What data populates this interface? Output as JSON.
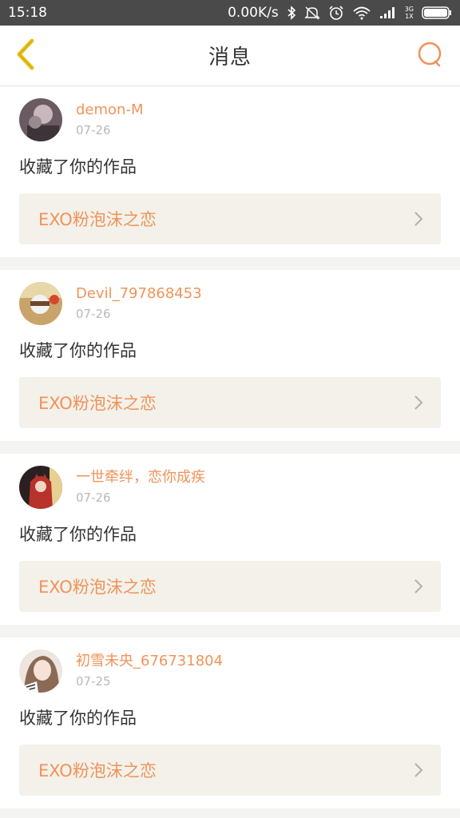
{
  "status_bar": {
    "time": "15:18",
    "net_speed": "0.00K/s",
    "icons": [
      "bluetooth-icon",
      "mute-icon",
      "alarm-icon",
      "wifi-icon",
      "signal-icon",
      "battery-icon"
    ],
    "network_label_top": "3G",
    "network_label_bottom": "1X"
  },
  "header": {
    "title": "消息",
    "back_icon": "chevron-left-icon",
    "search_icon": "search-icon"
  },
  "colors": {
    "accent": "#f0935a",
    "back_icon": "#e8c21a",
    "card_link_bg": "#f3f1e9",
    "page_bg": "#f4f4f2",
    "date": "#b9b9b9",
    "text": "#333333"
  },
  "messages": [
    {
      "username": "demon-M",
      "date": "07-26",
      "action": "收藏了你的作品",
      "work_title": "EXO粉泡沫之恋",
      "avatar_color": "#6a5a62"
    },
    {
      "username": "Devil_797868453",
      "date": "07-26",
      "action": "收藏了你的作品",
      "work_title": "EXO粉泡沫之恋",
      "avatar_color": "#c9a46a"
    },
    {
      "username": "一世牵绊，恋你成疾",
      "date": "07-26",
      "action": "收藏了你的作品",
      "work_title": "EXO粉泡沫之恋",
      "avatar_color": "#b8332c"
    },
    {
      "username": "初雪未央_676731804",
      "date": "07-25",
      "action": "收藏了你的作品",
      "work_title": "EXO粉泡沫之恋",
      "avatar_color": "#d9c9c0"
    }
  ]
}
